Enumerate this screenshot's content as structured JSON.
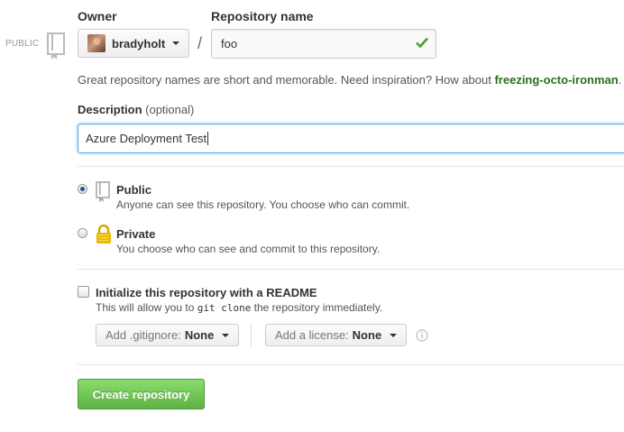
{
  "visibility_tag": "PUBLIC",
  "owner": {
    "label": "Owner",
    "name": "bradyholt"
  },
  "repo_name": {
    "label": "Repository name",
    "value": "foo",
    "separator": "/"
  },
  "hint": {
    "text": "Great repository names are short and memorable. Need inspiration? How about ",
    "suggestion": "freezing-octo-ironman",
    "end": "."
  },
  "description": {
    "label": "Description",
    "optional": "(optional)",
    "value": "Azure Deployment Test"
  },
  "visibility": {
    "public": {
      "title": "Public",
      "desc": "Anyone can see this repository. You choose who can commit.",
      "selected": true
    },
    "private": {
      "title": "Private",
      "desc": "You choose who can see and commit to this repository.",
      "selected": false
    }
  },
  "readme": {
    "title": "Initialize this repository with a README",
    "desc_before": "This will allow you to ",
    "desc_code": "git clone",
    "desc_after": " the repository immediately."
  },
  "gitignore": {
    "label": "Add .gitignore:",
    "value": "None"
  },
  "license": {
    "label": "Add a license:",
    "value": "None"
  },
  "create_button": "Create repository",
  "colors": {
    "accent_green": "#60b044",
    "suggestion_green": "#2a6e1e",
    "focus_blue": "#51a7e8"
  },
  "icons": [
    "repo-icon",
    "check-icon",
    "lock-icon",
    "info-icon",
    "caret-down-icon"
  ]
}
